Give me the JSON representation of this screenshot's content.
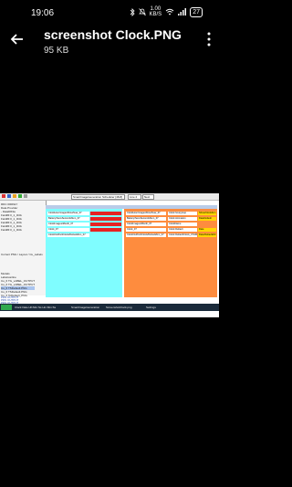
{
  "status": {
    "time": "19:06",
    "speed_value": "1.00",
    "speed_unit": "KB/S",
    "battery": "27"
  },
  "header": {
    "title": "screenshot Clock.PNG",
    "size": "95 KB",
    "back_icon": "arrow-left-icon",
    "menu_icon": "more-vert-icon"
  },
  "screenshot": {
    "toolbar_combo": "SmartImageGeneration Scheduler [48-8]",
    "toolbar_box2": "Line 2",
    "toolbar_box3": "Next",
    "panel_lines": [
      "RDC 000KEY",
      "Data Provider",
      "  - DataDfFile",
      "    Fieldfill 0_1_0Clk",
      "    Fieldfill 0_1_0Clk",
      "    Fieldfill 0_1_0Clk",
      "    Fieldfill 0_1_0Clk",
      "    Fieldfill 0_1_0Clk",
      "Current PNG / Layout / Cu_Labels"
    ],
    "tree_lines": [
      "Models",
      "  Labelsonline",
      "    Cu_6 TG_LABEL_OUTPUT",
      "    Cu_6 TG_LABEL_OUTPUT",
      "    Cu_6 TSDefault.PNG",
      "    Cu_6 TSDefault.PNG",
      "    Cu_6 ToDefault_PNG",
      "  PDS OUTPUT",
      "  PDS OUTPUT",
      "  PDS OUTPUT"
    ],
    "cyan_rows": [
      "ClockHourImagesShowNuw_07",
      "Battery/SecsSecondsNum_07",
      "ClockImages/Month_07",
      "Clock_07",
      "ClockOutPart/Clock/Default/Hm_07"
    ],
    "orange_rows": [
      "ClockHourImagesShowNuw_07",
      "Battery/SecsSecondsNum_07",
      "ClockImages/Month_07",
      "Clock_07",
      "ClockOutPart/Clock/Default/Hm_07"
    ],
    "orange_values": [
      "Clock hourgroup",
      "Clock Animation",
      "ClockName",
      "Clock Default",
      "Clock Default/Clock_07HM"
    ],
    "yellow_values": [
      "Show/Clock/Hm",
      "DateDefault",
      "Date",
      "Date/DefaultHM"
    ],
    "taskbar_items": [
      "Clock Date Hh:Mm:Ss Hm:Mm:Ss",
      "SmartImageGeneration",
      "ScreenshotClock.png",
      "Settings"
    ]
  }
}
